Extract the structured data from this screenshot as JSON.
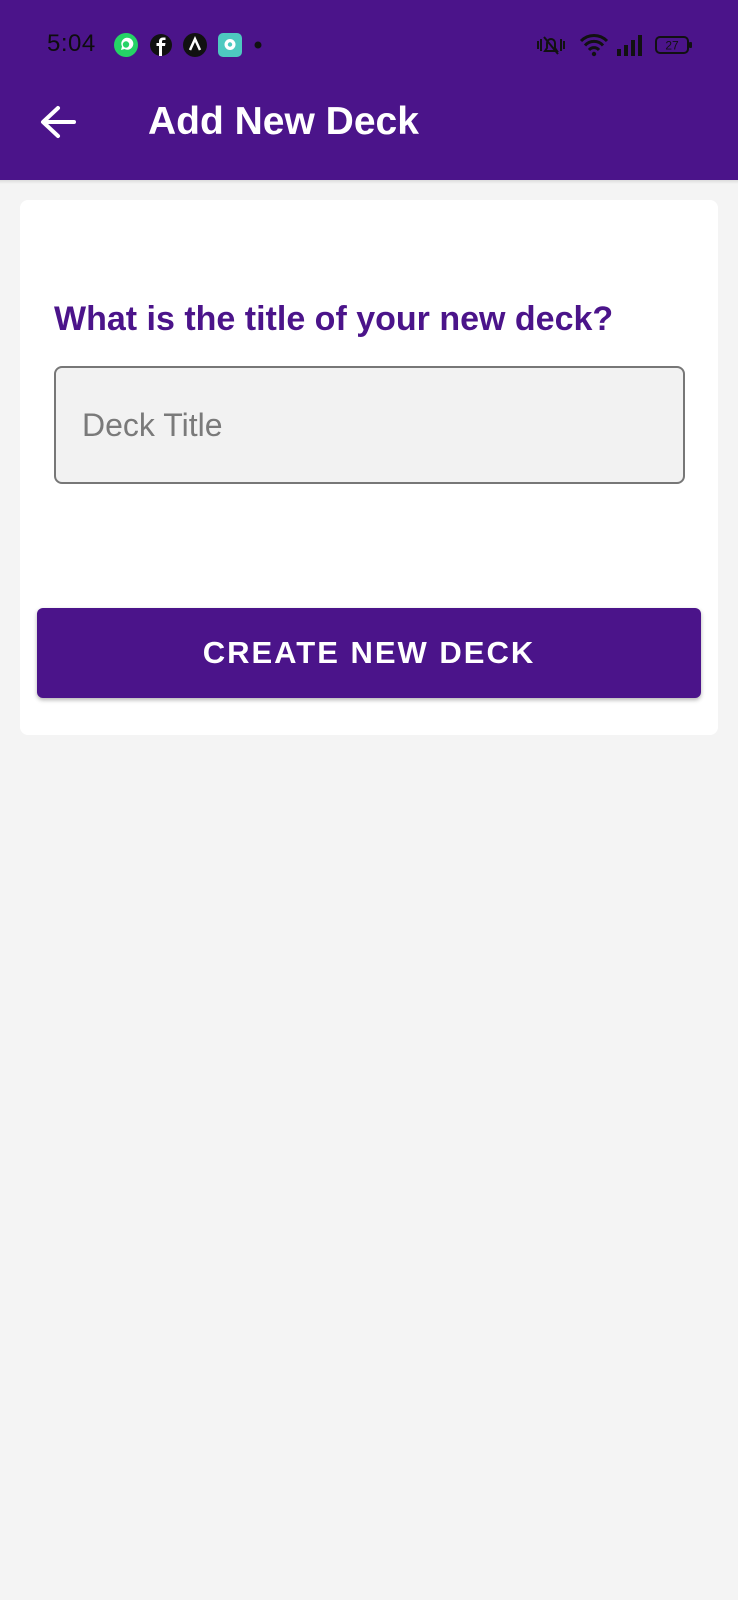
{
  "status_bar": {
    "time": "5:04",
    "battery": "27",
    "icons": [
      "whatsapp-icon",
      "facebook-icon",
      "notification-a-icon",
      "chat-app-icon",
      "dot-icon",
      "vibrate-icon",
      "wifi-icon",
      "signal-icon",
      "battery-icon"
    ]
  },
  "header": {
    "title": "Add New Deck",
    "back_icon": "arrow-left-icon",
    "background": "#4b148a"
  },
  "form": {
    "question": "What is the title of your new deck?",
    "input_placeholder": "Deck Title",
    "input_value": "",
    "submit_label": "CREATE NEW DECK"
  },
  "colors": {
    "primary": "#4b148a",
    "page_background": "#f4f4f4",
    "card_background": "#ffffff"
  }
}
